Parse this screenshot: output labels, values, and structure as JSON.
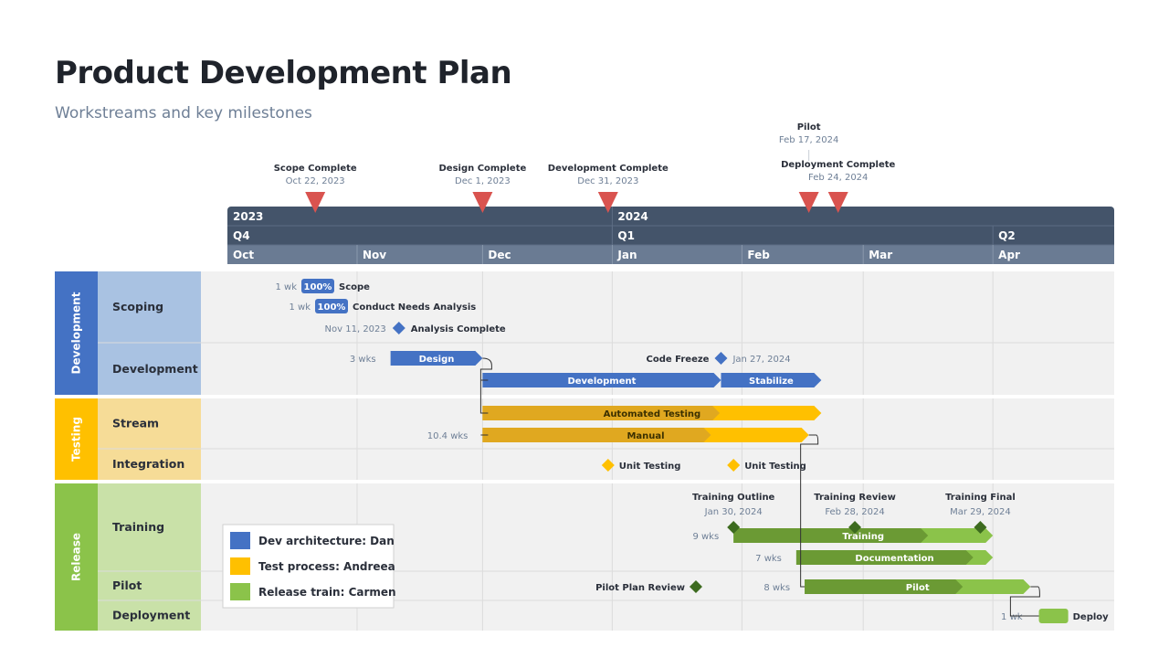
{
  "header": {
    "title": "Product Development Plan",
    "subtitle": "Workstreams and key milestones"
  },
  "colors": {
    "development": "#4472c4",
    "testing": "#ffc000",
    "release": "#8bc34a",
    "milestone_red": "#d9534f",
    "header_dark": "#44546a",
    "header_light": "#6a7b93"
  },
  "timescale": {
    "years": [
      "2023",
      "2024"
    ],
    "quarters": [
      "Q4",
      "Q1",
      "Q2"
    ],
    "months": [
      "Oct",
      "Nov",
      "Dec",
      "Jan",
      "Feb",
      "Mar",
      "Apr"
    ]
  },
  "header_milestones": [
    {
      "label": "Scope Complete",
      "date": "Oct 22, 2023"
    },
    {
      "label": "Design Complete",
      "date": "Dec 1, 2023"
    },
    {
      "label": "Development Complete",
      "date": "Dec 31, 2023"
    },
    {
      "label": "Pilot",
      "date": "Feb 17, 2024"
    },
    {
      "label": "Deployment Complete",
      "date": "Feb 24, 2024"
    }
  ],
  "groups": [
    {
      "label": "Development",
      "rows": [
        "Scoping",
        "Development"
      ]
    },
    {
      "label": "Testing",
      "rows": [
        "Stream",
        "Integration"
      ]
    },
    {
      "label": "Release",
      "rows": [
        "Training",
        "Pilot",
        "Deployment"
      ]
    }
  ],
  "tasks": [
    {
      "row": "Scoping",
      "label": "Scope",
      "duration": "1 wk",
      "percent": "100%",
      "group": "development",
      "start": "2023-10-15",
      "end": "2023-10-22"
    },
    {
      "row": "Scoping",
      "label": "Conduct Needs Analysis",
      "duration": "1 wk",
      "percent": "100%",
      "group": "development",
      "start": "2023-10-22",
      "end": "2023-10-29"
    },
    {
      "row": "Development",
      "label": "Design",
      "duration": "3 wks",
      "progress": 1.0,
      "group": "development",
      "start": "2023-11-09",
      "end": "2023-12-01"
    },
    {
      "row": "Development",
      "label": "Development",
      "progress": 1.0,
      "group": "development",
      "start": "2023-12-01",
      "end": "2024-01-27"
    },
    {
      "row": "Development",
      "label": "Stabilize",
      "progress": 1.0,
      "group": "development",
      "start": "2024-01-27",
      "end": "2024-02-20"
    },
    {
      "row": "Stream",
      "label": "Automated Testing",
      "progress": 0.7,
      "group": "testing",
      "start": "2023-12-01",
      "end": "2024-02-20"
    },
    {
      "row": "Stream",
      "label": "Manual",
      "duration": "10.4 wks",
      "progress": 0.7,
      "group": "testing",
      "start": "2023-12-01",
      "end": "2024-02-17"
    },
    {
      "row": "Training",
      "label": "Training",
      "duration": "9 wks",
      "progress": 0.75,
      "group": "release",
      "start": "2024-01-30",
      "end": "2024-04-01"
    },
    {
      "row": "Training",
      "label": "Documentation",
      "duration": "7 wks",
      "progress": 0.9,
      "group": "release",
      "start": "2024-02-14",
      "end": "2024-04-01"
    },
    {
      "row": "Pilot",
      "label": "Pilot",
      "duration": "8 wks",
      "progress": 0.7,
      "group": "release",
      "start": "2024-02-16",
      "end": "2024-04-10"
    },
    {
      "row": "Deployment",
      "label": "Deploy",
      "duration": "1 wk",
      "progress": 1.0,
      "group": "release",
      "start": "2024-04-12",
      "end": "2024-04-19"
    }
  ],
  "milestones": [
    {
      "row": "Scoping",
      "label": "Analysis Complete",
      "date": "Nov 11, 2023",
      "group": "development"
    },
    {
      "row": "Development",
      "label": "Code Freeze",
      "date": "Jan 27, 2024",
      "group": "development"
    },
    {
      "row": "Integration",
      "label": "Unit Testing",
      "group": "testing",
      "at": "2023-12-31"
    },
    {
      "row": "Integration",
      "label": "Unit Testing",
      "group": "testing",
      "at": "2024-01-30"
    },
    {
      "row": "Training",
      "label": "Training Outline",
      "date": "Jan 30, 2024",
      "group": "release"
    },
    {
      "row": "Training",
      "label": "Training Review",
      "date": "Feb 28, 2024",
      "group": "release"
    },
    {
      "row": "Training",
      "label": "Training Final",
      "date": "Mar 29, 2024",
      "group": "release"
    },
    {
      "row": "Pilot",
      "label": "Pilot Plan Review",
      "group": "release",
      "at": "2024-01-21"
    }
  ],
  "legend": [
    {
      "label": "Dev architecture: Dan",
      "color": "#4472c4"
    },
    {
      "label": "Test process: Andreea",
      "color": "#ffc000"
    },
    {
      "label": "Release train: Carmen",
      "color": "#8bc34a"
    }
  ]
}
